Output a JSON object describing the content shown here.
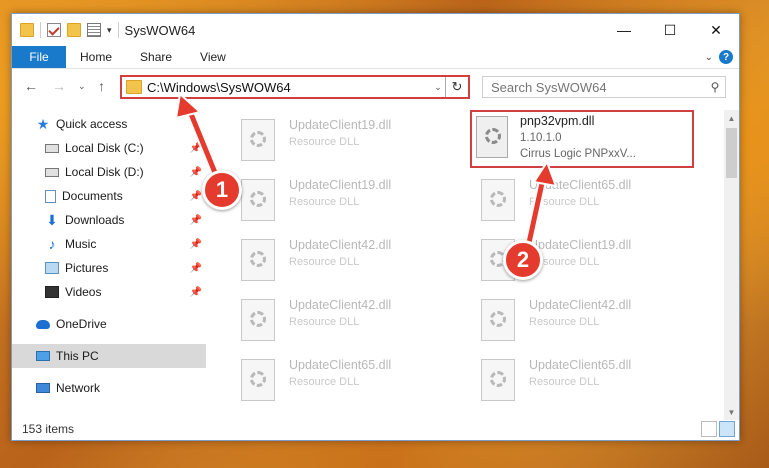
{
  "window": {
    "title": "SysWOW64"
  },
  "ribbon": {
    "tabs": [
      "File",
      "Home",
      "Share",
      "View"
    ]
  },
  "address": {
    "path": "C:\\Windows\\SysWOW64"
  },
  "search": {
    "placeholder": "Search SysWOW64"
  },
  "sidebar": {
    "items": [
      {
        "label": "Quick access",
        "icon": "star-icon"
      },
      {
        "label": "Local Disk (C:)",
        "icon": "disk-icon",
        "pinned": true
      },
      {
        "label": "Local Disk (D:)",
        "icon": "disk-icon",
        "pinned": true
      },
      {
        "label": "Documents",
        "icon": "documents-icon",
        "pinned": true
      },
      {
        "label": "Downloads",
        "icon": "downloads-icon",
        "pinned": true
      },
      {
        "label": "Music",
        "icon": "music-icon",
        "pinned": true
      },
      {
        "label": "Pictures",
        "icon": "pictures-icon",
        "pinned": true
      },
      {
        "label": "Videos",
        "icon": "videos-icon",
        "pinned": true
      },
      {
        "label": "OneDrive",
        "icon": "onedrive-icon"
      },
      {
        "label": "This PC",
        "icon": "this-pc-icon",
        "selected": true
      },
      {
        "label": "Network",
        "icon": "network-icon"
      }
    ]
  },
  "files": {
    "highlighted": {
      "name": "pnp32vpm.dll",
      "version": "1.10.1.0",
      "company": "Cirrus Logic PNPxxV..."
    },
    "left": [
      {
        "name": "UpdateClient19.dll",
        "type": "Resource DLL"
      },
      {
        "name": "UpdateClient19.dll",
        "type": "Resource DLL"
      },
      {
        "name": "UpdateClient42.dll",
        "type": "Resource DLL"
      },
      {
        "name": "UpdateClient42.dll",
        "type": "Resource DLL"
      },
      {
        "name": "UpdateClient65.dll",
        "type": "Resource DLL"
      }
    ],
    "right": [
      {
        "name": "UpdateClient65.dll",
        "type": "Resource DLL"
      },
      {
        "name": "UpdateClient19.dll",
        "type": "Resource DLL"
      },
      {
        "name": "UpdateClient42.dll",
        "type": "Resource DLL"
      },
      {
        "name": "UpdateClient65.dll",
        "type": "Resource DLL"
      }
    ]
  },
  "status": {
    "item_count": "153 items"
  },
  "callouts": [
    "1",
    "2"
  ],
  "colors": {
    "accent": "#1979ca",
    "annotation_red": "#e53b2e"
  }
}
